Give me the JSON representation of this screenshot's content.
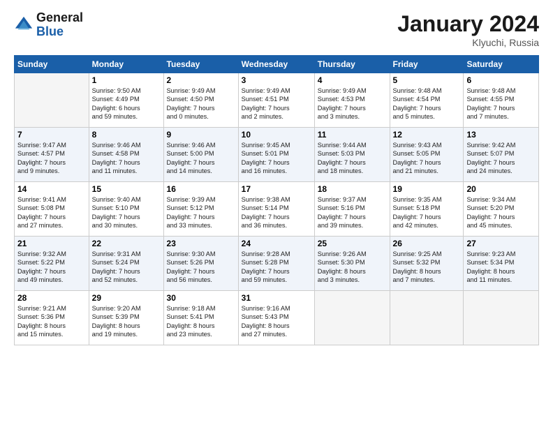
{
  "header": {
    "logo_general": "General",
    "logo_blue": "Blue",
    "month_year": "January 2024",
    "location": "Klyuchi, Russia"
  },
  "days_of_week": [
    "Sunday",
    "Monday",
    "Tuesday",
    "Wednesday",
    "Thursday",
    "Friday",
    "Saturday"
  ],
  "weeks": [
    [
      {
        "day": "",
        "info": ""
      },
      {
        "day": "1",
        "info": "Sunrise: 9:50 AM\nSunset: 4:49 PM\nDaylight: 6 hours\nand 59 minutes."
      },
      {
        "day": "2",
        "info": "Sunrise: 9:49 AM\nSunset: 4:50 PM\nDaylight: 7 hours\nand 0 minutes."
      },
      {
        "day": "3",
        "info": "Sunrise: 9:49 AM\nSunset: 4:51 PM\nDaylight: 7 hours\nand 2 minutes."
      },
      {
        "day": "4",
        "info": "Sunrise: 9:49 AM\nSunset: 4:53 PM\nDaylight: 7 hours\nand 3 minutes."
      },
      {
        "day": "5",
        "info": "Sunrise: 9:48 AM\nSunset: 4:54 PM\nDaylight: 7 hours\nand 5 minutes."
      },
      {
        "day": "6",
        "info": "Sunrise: 9:48 AM\nSunset: 4:55 PM\nDaylight: 7 hours\nand 7 minutes."
      }
    ],
    [
      {
        "day": "7",
        "info": "Sunrise: 9:47 AM\nSunset: 4:57 PM\nDaylight: 7 hours\nand 9 minutes."
      },
      {
        "day": "8",
        "info": "Sunrise: 9:46 AM\nSunset: 4:58 PM\nDaylight: 7 hours\nand 11 minutes."
      },
      {
        "day": "9",
        "info": "Sunrise: 9:46 AM\nSunset: 5:00 PM\nDaylight: 7 hours\nand 14 minutes."
      },
      {
        "day": "10",
        "info": "Sunrise: 9:45 AM\nSunset: 5:01 PM\nDaylight: 7 hours\nand 16 minutes."
      },
      {
        "day": "11",
        "info": "Sunrise: 9:44 AM\nSunset: 5:03 PM\nDaylight: 7 hours\nand 18 minutes."
      },
      {
        "day": "12",
        "info": "Sunrise: 9:43 AM\nSunset: 5:05 PM\nDaylight: 7 hours\nand 21 minutes."
      },
      {
        "day": "13",
        "info": "Sunrise: 9:42 AM\nSunset: 5:07 PM\nDaylight: 7 hours\nand 24 minutes."
      }
    ],
    [
      {
        "day": "14",
        "info": "Sunrise: 9:41 AM\nSunset: 5:08 PM\nDaylight: 7 hours\nand 27 minutes."
      },
      {
        "day": "15",
        "info": "Sunrise: 9:40 AM\nSunset: 5:10 PM\nDaylight: 7 hours\nand 30 minutes."
      },
      {
        "day": "16",
        "info": "Sunrise: 9:39 AM\nSunset: 5:12 PM\nDaylight: 7 hours\nand 33 minutes."
      },
      {
        "day": "17",
        "info": "Sunrise: 9:38 AM\nSunset: 5:14 PM\nDaylight: 7 hours\nand 36 minutes."
      },
      {
        "day": "18",
        "info": "Sunrise: 9:37 AM\nSunset: 5:16 PM\nDaylight: 7 hours\nand 39 minutes."
      },
      {
        "day": "19",
        "info": "Sunrise: 9:35 AM\nSunset: 5:18 PM\nDaylight: 7 hours\nand 42 minutes."
      },
      {
        "day": "20",
        "info": "Sunrise: 9:34 AM\nSunset: 5:20 PM\nDaylight: 7 hours\nand 45 minutes."
      }
    ],
    [
      {
        "day": "21",
        "info": "Sunrise: 9:32 AM\nSunset: 5:22 PM\nDaylight: 7 hours\nand 49 minutes."
      },
      {
        "day": "22",
        "info": "Sunrise: 9:31 AM\nSunset: 5:24 PM\nDaylight: 7 hours\nand 52 minutes."
      },
      {
        "day": "23",
        "info": "Sunrise: 9:30 AM\nSunset: 5:26 PM\nDaylight: 7 hours\nand 56 minutes."
      },
      {
        "day": "24",
        "info": "Sunrise: 9:28 AM\nSunset: 5:28 PM\nDaylight: 7 hours\nand 59 minutes."
      },
      {
        "day": "25",
        "info": "Sunrise: 9:26 AM\nSunset: 5:30 PM\nDaylight: 8 hours\nand 3 minutes."
      },
      {
        "day": "26",
        "info": "Sunrise: 9:25 AM\nSunset: 5:32 PM\nDaylight: 8 hours\nand 7 minutes."
      },
      {
        "day": "27",
        "info": "Sunrise: 9:23 AM\nSunset: 5:34 PM\nDaylight: 8 hours\nand 11 minutes."
      }
    ],
    [
      {
        "day": "28",
        "info": "Sunrise: 9:21 AM\nSunset: 5:36 PM\nDaylight: 8 hours\nand 15 minutes."
      },
      {
        "day": "29",
        "info": "Sunrise: 9:20 AM\nSunset: 5:39 PM\nDaylight: 8 hours\nand 19 minutes."
      },
      {
        "day": "30",
        "info": "Sunrise: 9:18 AM\nSunset: 5:41 PM\nDaylight: 8 hours\nand 23 minutes."
      },
      {
        "day": "31",
        "info": "Sunrise: 9:16 AM\nSunset: 5:43 PM\nDaylight: 8 hours\nand 27 minutes."
      },
      {
        "day": "",
        "info": ""
      },
      {
        "day": "",
        "info": ""
      },
      {
        "day": "",
        "info": ""
      }
    ]
  ]
}
